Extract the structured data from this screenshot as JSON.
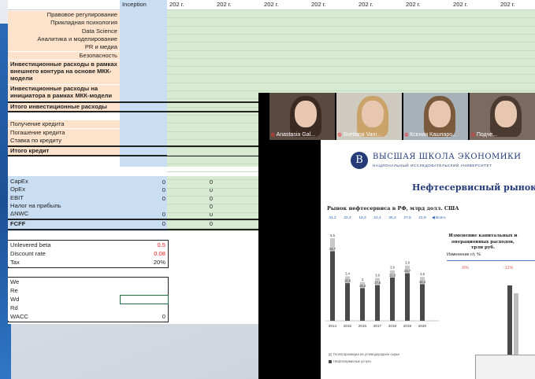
{
  "sheet": {
    "header": {
      "inception": "Inception",
      "years": [
        "202 г.",
        "202 г.",
        "202 г.",
        "202 г.",
        "202 г.",
        "202 г.",
        "202 г.",
        "202 г."
      ]
    },
    "invest_rows": [
      "Правовое регулирование",
      "Прикладная психология",
      "Data Science",
      "Аналитика и моделирование",
      "PR и медиа",
      "Безопасность"
    ],
    "invest_external": "Инвестиционные расходы в рамках внешнего контура на основе МКК-модели",
    "invest_initiator": "Инвестиционные расходы на инициатора в рамках МКК-модели",
    "invest_total": "Итого инвестиционные расходы",
    "credit_rows": [
      "Получение кредита",
      "Погашение кредита",
      "Ставка по кредиту"
    ],
    "credit_total": "Итого кредит",
    "flow_rows": [
      {
        "label": "CapEx",
        "v1": "0",
        "v2": "0"
      },
      {
        "label": "OpEx",
        "v1": "0",
        "v2": "0"
      },
      {
        "label": "EBIT",
        "v1": "0",
        "v2": "0"
      },
      {
        "label": "Налог на прибыль",
        "v1": "",
        "v2": "0"
      },
      {
        "label": "ΔNWC",
        "v1": "0",
        "v2": "0"
      }
    ],
    "fcff": {
      "label": "FCFF",
      "v1": "0",
      "v2": "0"
    },
    "params": [
      {
        "label": "Unlevered beta",
        "value": "0.5",
        "color": "#e02020"
      },
      {
        "label": "Discount rate",
        "value": "0.08",
        "color": "#e02020"
      },
      {
        "label": "Tax",
        "value": "20%",
        "color": "#222222"
      }
    ],
    "wacc": [
      {
        "label": "We",
        "value": ""
      },
      {
        "label": "Re",
        "value": ""
      },
      {
        "label": "Wd",
        "value": ""
      },
      {
        "label": "Rd",
        "value": ""
      },
      {
        "label": "WACC",
        "value": "0"
      }
    ]
  },
  "zoom": {
    "participants": [
      {
        "name": "Anastasia Gal...",
        "hair": "#3a2a20"
      },
      {
        "name": "Svetlana Vani...",
        "hair": "#c9a36a"
      },
      {
        "name": "Ксения Кашпаро...",
        "hair": "#7a5a3c"
      },
      {
        "name": "Подче...",
        "hair": "#4a3a30"
      }
    ],
    "slide": {
      "logo_letter": "В",
      "university": "ВЫСШАЯ ШКОЛА ЭКОНОМИКИ",
      "university_sub": "НАЦИОНАЛЬНЫЙ ИССЛЕДОВАТЕЛЬСКИЙ УНИВЕРСИТЕТ",
      "title": "Нефтесервисный рынок Р",
      "right_title": "Изменение капитальных и операционных расходов, трлн руб.",
      "right_sub": "Изменение г/г, %",
      "right_pcts": [
        "-6%",
        "-11%"
      ],
      "legend": [
        "Геологоразведка на углеводородное сырье",
        "Нефтесервисные услуги"
      ]
    }
  },
  "chart_data": {
    "type": "bar",
    "title": "Рынок нефтесервиса в РФ, млрд долл. США",
    "categories": [
      "2014",
      "2015",
      "2016",
      "2017",
      "2018",
      "2019",
      "2020"
    ],
    "totals": [
      "41,2",
      "22,4",
      "19,3",
      "21,4",
      "25,2",
      "27,5",
      "21,9"
    ],
    "series": [
      {
        "name": "Геологоразведка на углеводородное сырье",
        "values": [
          6.5,
          3.4,
          3.0,
          3.6,
          3.6,
          3.9,
          3.6
        ],
        "color": "#c8c8c8"
      },
      {
        "name": "Нефтесервисные услуги",
        "values": [
          34.7,
          18.8,
          16.3,
          17.8,
          21.6,
          23.7,
          18.3
        ],
        "color": "#4a4a4a"
      }
    ],
    "legend_marker": "◀ Всего"
  }
}
